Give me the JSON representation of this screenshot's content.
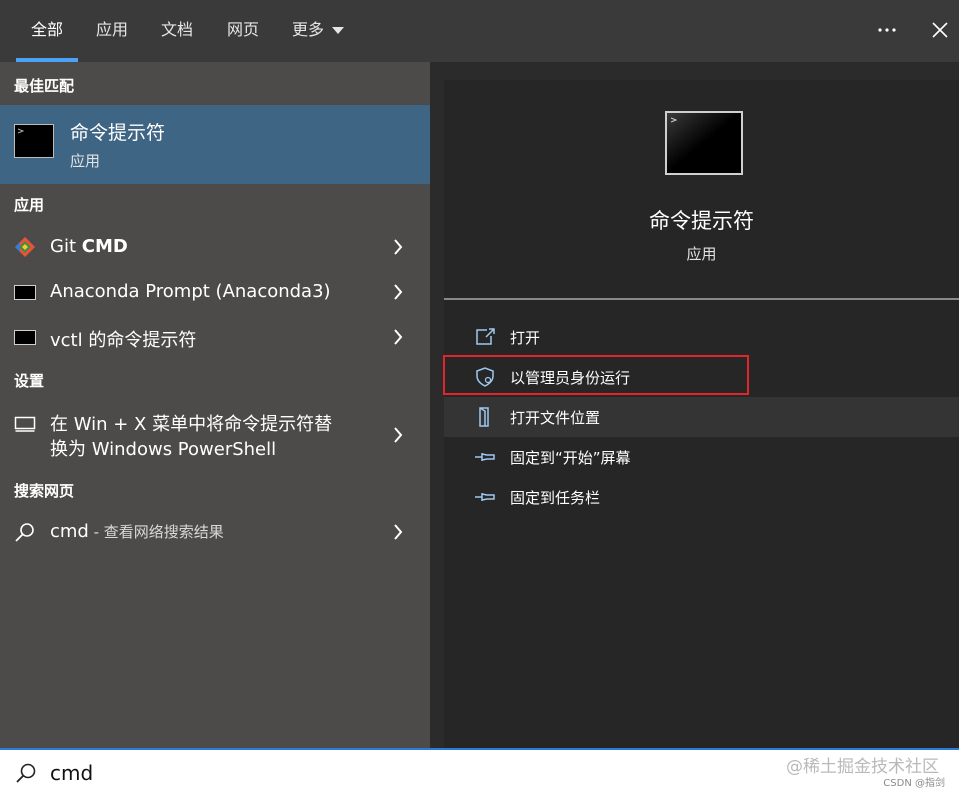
{
  "tabs": [
    {
      "label": "全部",
      "active": true
    },
    {
      "label": "应用",
      "active": false
    },
    {
      "label": "文档",
      "active": false
    },
    {
      "label": "网页",
      "active": false
    },
    {
      "label": "更多",
      "active": false
    }
  ],
  "top_icons": {
    "more": "more-icon",
    "close": "close-icon"
  },
  "sections": {
    "best_match": "最佳匹配",
    "apps": "应用",
    "settings": "设置",
    "web": "搜索网页"
  },
  "best_match": {
    "title": "命令提示符",
    "subtitle": "应用",
    "icon": "terminal-icon"
  },
  "app_items": [
    {
      "label_prefix": "Git ",
      "label_bold": "CMD",
      "icon": "git-icon"
    },
    {
      "label": "Anaconda Prompt (Anaconda3)",
      "icon": "terminal-icon"
    },
    {
      "label": "vctl 的命令提示符",
      "icon": "terminal-icon"
    }
  ],
  "settings_items": [
    {
      "line1": "在 Win + X 菜单中将命令提示符替",
      "line2": "换为 Windows PowerShell",
      "icon": "monitor-icon"
    }
  ],
  "web_items": [
    {
      "label": "cmd",
      "suffix": " - 查看网络搜索结果",
      "icon": "search-icon"
    }
  ],
  "preview": {
    "title": "命令提示符",
    "subtitle": "应用",
    "icon": "terminal-icon"
  },
  "actions": [
    {
      "label": "打开",
      "icon": "open-icon"
    },
    {
      "label": "以管理员身份运行",
      "icon": "shield-icon"
    },
    {
      "label": "打开文件位置",
      "icon": "file-location-icon"
    },
    {
      "label": "固定到“开始”屏幕",
      "icon": "pin-icon"
    },
    {
      "label": "固定到任务栏",
      "icon": "pin-icon"
    }
  ],
  "search": {
    "value": "cmd",
    "icon": "search-icon"
  },
  "watermark": {
    "text": "@稀土掘金技术社区",
    "sub": "CSDN @指剑"
  },
  "colors": {
    "accent": "#4ba3f5",
    "selected": "#3f6584",
    "highlight_box": "#e0262a"
  }
}
